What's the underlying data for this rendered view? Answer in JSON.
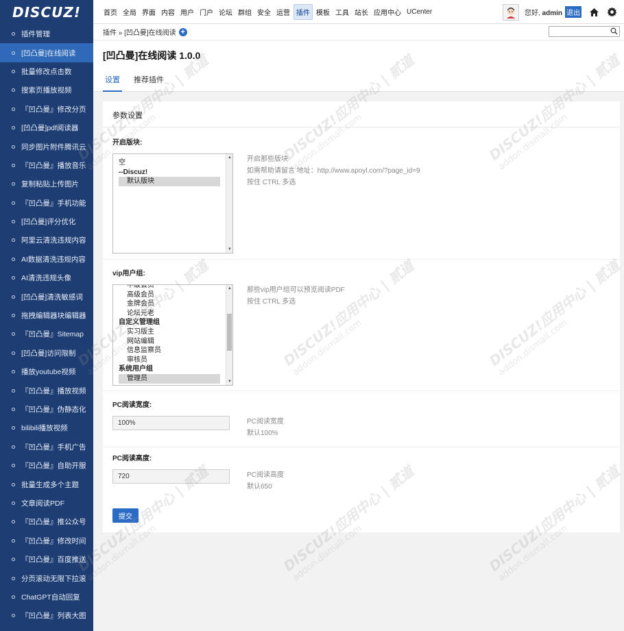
{
  "app": {
    "logo": "DISCUZ!"
  },
  "sidebar": {
    "items": [
      "插件管理",
      "[凹凸曼]在线阅读",
      "批量修改点击数",
      "搜索页播放视频",
      "『凹凸曼』修改分页",
      "[凹凸曼]pdf阅读器",
      "同步图片附件腾讯云",
      "『凹凸曼』播放音乐",
      "复制粘贴上传图片",
      "『凹凸曼』手机功能",
      "[凹凸曼]评分优化",
      "阿里云清洗违规内容",
      "AI数据清洗违规内容",
      "AI清洗违规头像",
      "[凹凸曼]清洗敏感词",
      "拖拽编辑器块编辑器",
      "『凹凸曼』Sitemap",
      "[凹凸曼]访问限制",
      "播放youtube视频",
      "『凹凸曼』播放视频",
      "『凹凸曼』伪静态化",
      "bilibili播放视频",
      "『凹凸曼』手机广告",
      "『凹凸曼』自助开服",
      "批量生成多个主题",
      "文章阅读PDF",
      "『凹凸曼』推公众号",
      "『凹凸曼』修改时间",
      "『凹凸曼』百度推送",
      "分页滚动无限下拉滚",
      "ChatGPT自动回复",
      "『凹凸曼』列表大图"
    ],
    "active_index": 1
  },
  "topnav": {
    "items": [
      "首页",
      "全局",
      "界面",
      "内容",
      "用户",
      "门户",
      "论坛",
      "群组",
      "安全",
      "运营",
      "插件",
      "模板",
      "工具",
      "站长",
      "应用中心",
      "UCenter"
    ],
    "active_index": 10,
    "greeting": "您好,",
    "username": "admin",
    "logout": "退出"
  },
  "breadcrumb": {
    "path": "插件 » [凹凸曼]在线阅读",
    "add_symbol": "+"
  },
  "search": {
    "value": ""
  },
  "page": {
    "title": "[凹凸曼]在线阅读 1.0.0",
    "tabs": [
      "设置",
      "推荐插件"
    ],
    "active_tab": 0
  },
  "form": {
    "section_title": "参数设置",
    "block_label": "开启版块:",
    "block_options": [
      {
        "text": "空",
        "indent": 0,
        "bold": false,
        "selected": false
      },
      {
        "text": "--Discuz!",
        "indent": 0,
        "bold": true,
        "selected": false
      },
      {
        "text": "默认版块",
        "indent": 1,
        "bold": false,
        "selected": true
      }
    ],
    "block_hints": [
      "开启那些版块",
      "如需帮助请留言 地址：http://www.apoyl.com/?page_id=9",
      "按住 CTRL 多选"
    ],
    "vip_label": "vip用户组:",
    "vip_options": [
      {
        "text": "中级会员",
        "indent": 1,
        "bold": false,
        "selected": false
      },
      {
        "text": "高级会员",
        "indent": 1,
        "bold": false,
        "selected": false
      },
      {
        "text": "金牌会员",
        "indent": 1,
        "bold": false,
        "selected": false
      },
      {
        "text": "论坛元老",
        "indent": 1,
        "bold": false,
        "selected": false
      },
      {
        "text": "自定义管理组",
        "indent": 0,
        "bold": true,
        "selected": false
      },
      {
        "text": "实习版主",
        "indent": 1,
        "bold": false,
        "selected": false
      },
      {
        "text": "网站编辑",
        "indent": 1,
        "bold": false,
        "selected": false
      },
      {
        "text": "信息监察员",
        "indent": 1,
        "bold": false,
        "selected": false
      },
      {
        "text": "审核员",
        "indent": 1,
        "bold": false,
        "selected": false
      },
      {
        "text": "系统用户组",
        "indent": 0,
        "bold": true,
        "selected": false
      },
      {
        "text": "管理员",
        "indent": 1,
        "bold": false,
        "selected": true
      }
    ],
    "vip_hints": [
      "那些vip用户组可以预览阅读PDF",
      "按住 CTRL 多选"
    ],
    "width_label": "PC阅读宽度:",
    "width_value": "100%",
    "width_hints": [
      "PC阅读宽度",
      "默认100%"
    ],
    "height_label": "PC阅读高度:",
    "height_value": "720",
    "height_hints": [
      "PC阅读高度",
      "默认650"
    ],
    "submit": "提交"
  },
  "watermark": {
    "brand": "DISCUZ!应用中心 | 贰道",
    "domain": "addon.dismall.com"
  },
  "colors": {
    "sidebar_bg": "#1e3d72",
    "accent": "#2a6bc4",
    "active_item": "#2f69b8"
  },
  "icons": [
    "home-icon",
    "gear-icon",
    "search-icon",
    "plus-icon",
    "avatar-icon"
  ]
}
